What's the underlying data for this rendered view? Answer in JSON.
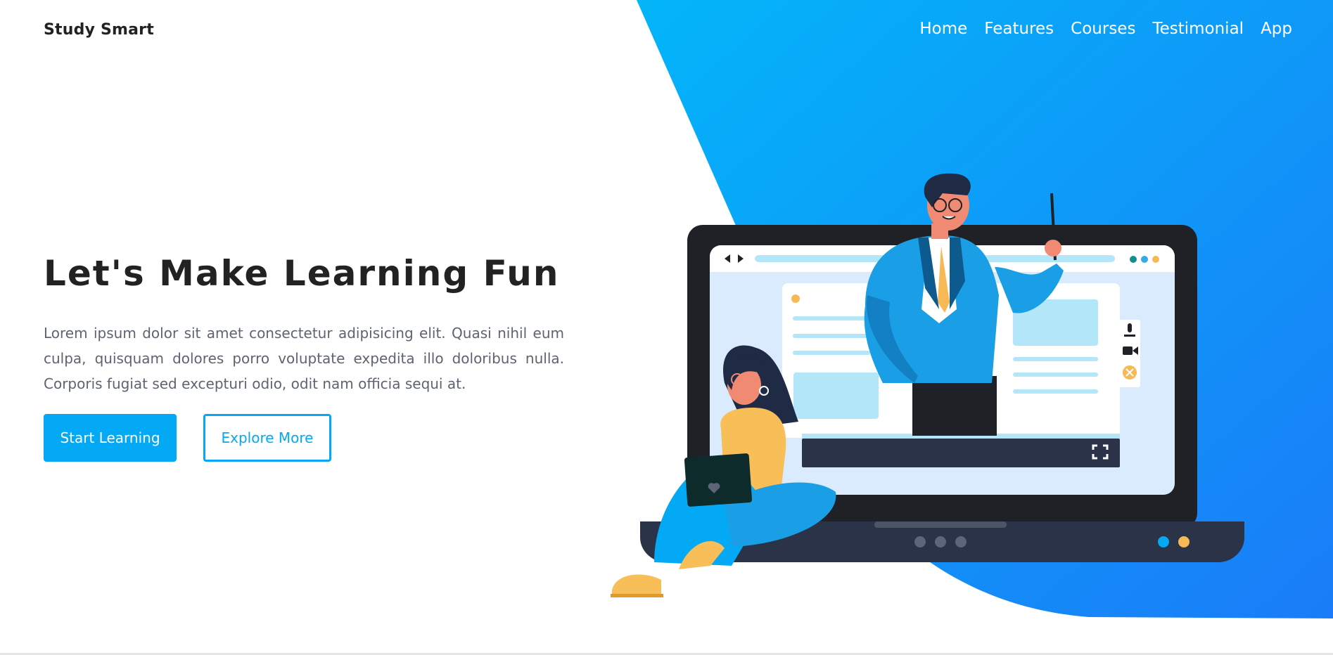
{
  "header": {
    "brand": "Study Smart",
    "nav": [
      "Home",
      "Features",
      "Courses",
      "Testimonial",
      "App"
    ]
  },
  "hero": {
    "title": "Let's Make Learning Fun",
    "description": "Lorem ipsum dolor sit amet consectetur adipisicing elit. Quasi nihil eum culpa, quisquam dolores porro voluptate expedita illo doloribus nulla. Corporis fugiat sed excepturi odio, odit nam officia sequi at.",
    "primary_button": "Start Learning",
    "secondary_button": "Explore More"
  },
  "theme": {
    "accent": "#03a9f4",
    "gradient_end": "#1a7cf8",
    "text_dark": "#222222",
    "text_muted": "#5d6470"
  },
  "illustration": {
    "icons": [
      "back-arrow-icon",
      "forward-arrow-icon",
      "microphone-icon",
      "video-camera-icon",
      "close-call-icon",
      "fullscreen-icon",
      "heart-icon"
    ]
  }
}
